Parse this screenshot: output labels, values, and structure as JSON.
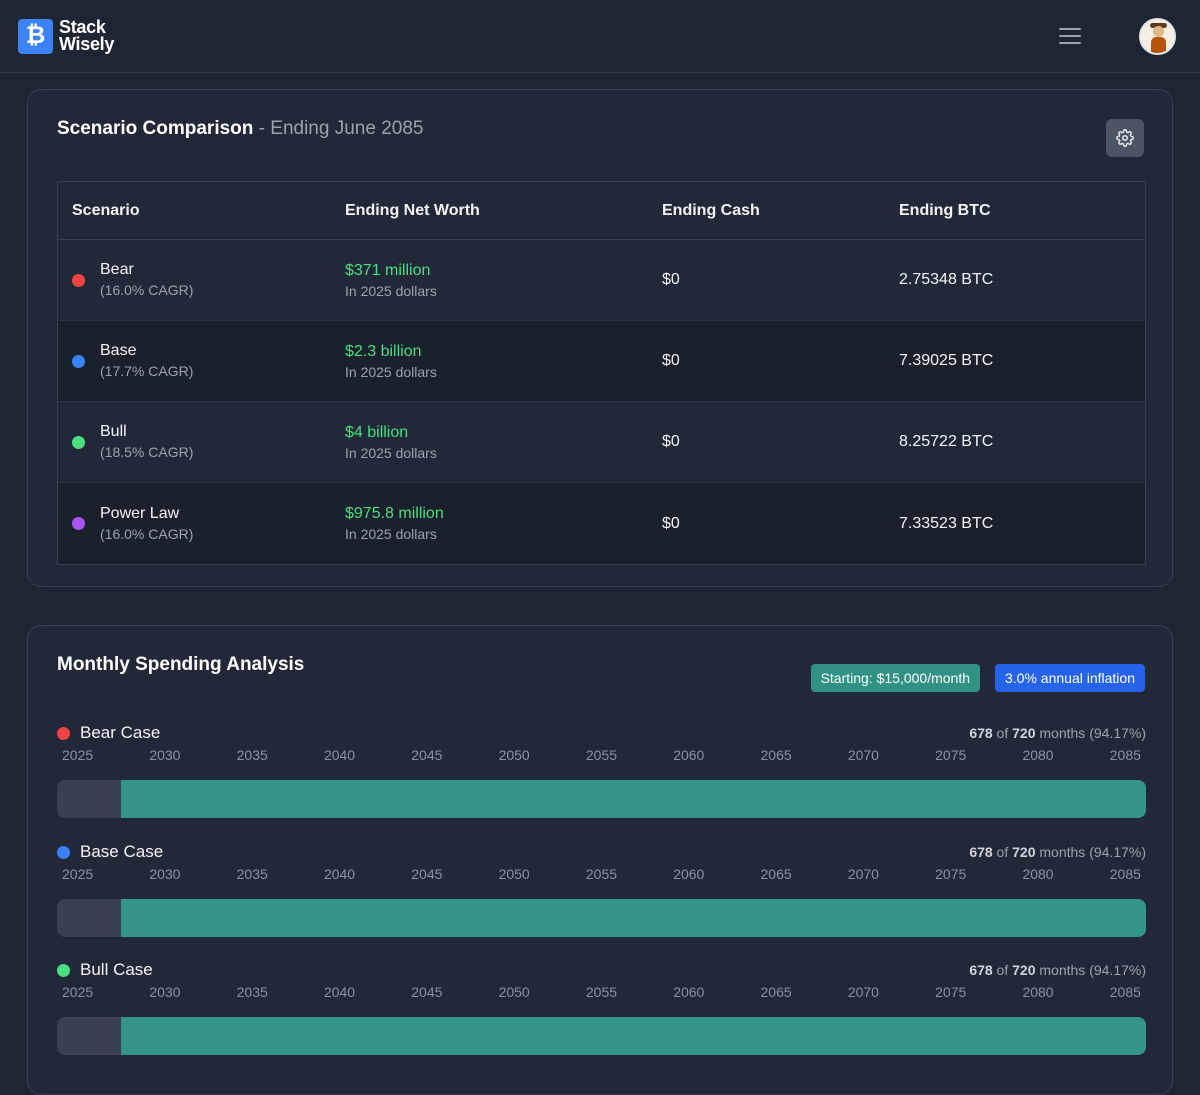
{
  "header": {
    "logo_glyph": "₿",
    "brand_line1": "Stack",
    "brand_line2": "Wisely",
    "menu_icon": "hamburger-menu-icon",
    "avatar_icon": "user-avatar"
  },
  "comparison": {
    "title": "Scenario Comparison",
    "subtitle": " - Ending June 2085",
    "settings_icon": "gear-icon",
    "columns": [
      "Scenario",
      "Ending Net Worth",
      "Ending Cash",
      "Ending BTC"
    ],
    "rows": [
      {
        "name": "Bear",
        "cagr": "(16.0% CAGR)",
        "color": "#ef4444",
        "net_worth": "$371 million",
        "net_worth_note": "In 2025 dollars",
        "cash": "$0",
        "btc": "2.75348 BTC"
      },
      {
        "name": "Base",
        "cagr": "(17.7% CAGR)",
        "color": "#3b82f6",
        "net_worth": "$2.3 billion",
        "net_worth_note": "In 2025 dollars",
        "cash": "$0",
        "btc": "7.39025 BTC"
      },
      {
        "name": "Bull",
        "cagr": "(18.5% CAGR)",
        "color": "#4ade80",
        "net_worth": "$4 billion",
        "net_worth_note": "In 2025 dollars",
        "cash": "$0",
        "btc": "8.25722 BTC"
      },
      {
        "name": "Power Law",
        "cagr": "(16.0% CAGR)",
        "color": "#a855f7",
        "net_worth": "$975.8 million",
        "net_worth_note": "In 2025 dollars",
        "cash": "$0",
        "btc": "7.33523 BTC"
      }
    ]
  },
  "spending": {
    "title": "Monthly Spending Analysis",
    "badge_start": "Starting: $15,000/month",
    "badge_inflation": "3.0% annual inflation",
    "years": [
      "2025",
      "2030",
      "2035",
      "2040",
      "2045",
      "2050",
      "2055",
      "2060",
      "2065",
      "2070",
      "2075",
      "2080",
      "2085"
    ],
    "cases": [
      {
        "label": "Bear Case",
        "color": "#ef4444",
        "funded": "678",
        "of_text": " of ",
        "total": "720",
        "suffix": " months (94.17%)",
        "fraction": 0.9417
      },
      {
        "label": "Base Case",
        "color": "#3b82f6",
        "funded": "678",
        "of_text": " of ",
        "total": "720",
        "suffix": " months (94.17%)",
        "fraction": 0.9417
      },
      {
        "label": "Bull Case",
        "color": "#4ade80",
        "funded": "678",
        "of_text": " of ",
        "total": "720",
        "suffix": " months (94.17%)",
        "fraction": 0.9417
      }
    ]
  }
}
